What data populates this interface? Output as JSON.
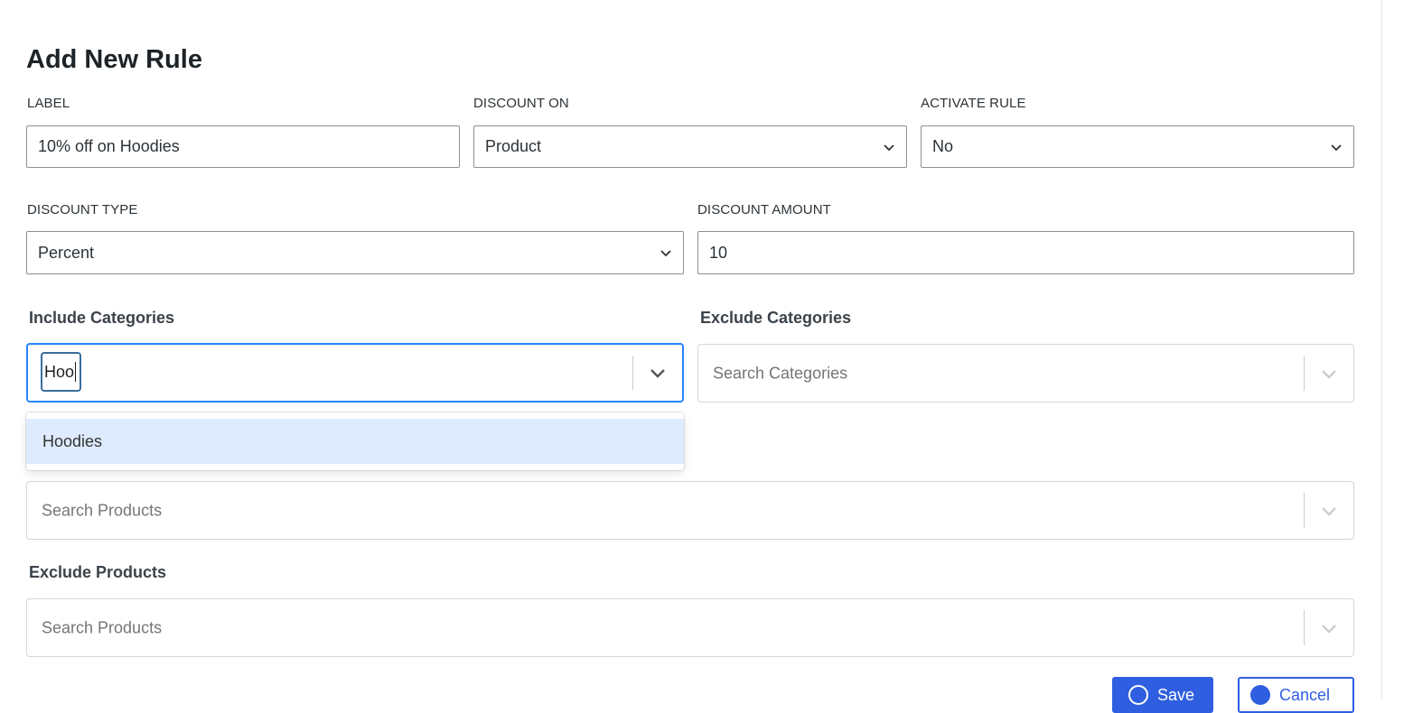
{
  "form": {
    "title": "Add New Rule",
    "label": {
      "label": "LABEL",
      "value": "10% off on Hoodies"
    },
    "discount_on": {
      "label": "DISCOUNT ON",
      "value": "Product"
    },
    "activate_rule": {
      "label": "ACTIVATE RULE",
      "value": "No"
    },
    "discount_type": {
      "label": "DISCOUNT TYPE",
      "value": "Percent"
    },
    "discount_amount": {
      "label": "DISCOUNT AMOUNT",
      "value": "10"
    },
    "include_categories": {
      "label": "Include Categories",
      "typed": "Hoo",
      "options": [
        "Hoodies"
      ]
    },
    "exclude_categories": {
      "label": "Exclude Categories",
      "placeholder": "Search Categories"
    },
    "include_products": {
      "placeholder": "Search Products"
    },
    "exclude_products": {
      "label": "Exclude Products",
      "placeholder": "Search Products"
    },
    "buttons": {
      "save": "Save",
      "cancel": "Cancel"
    }
  },
  "colors": {
    "accent": "#2f5fe0",
    "focus_border": "#2684ff",
    "option_highlight": "#deebff"
  },
  "icons": {
    "dropdown": "chevron-down-icon",
    "save": "save-icon",
    "cancel": "close-circle-icon"
  }
}
